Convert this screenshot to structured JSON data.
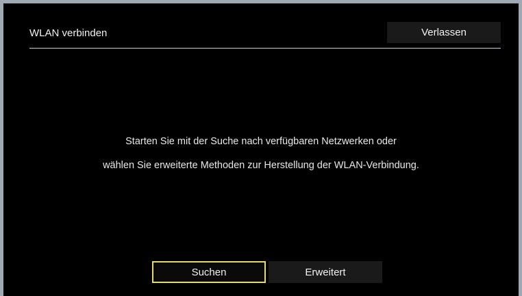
{
  "dialog": {
    "title": "WLAN verbinden",
    "exit_label": "Verlassen"
  },
  "message": {
    "line1": "Starten Sie mit der Suche nach verfügbaren Netzwerken oder",
    "line2": "wählen Sie erweiterte Methoden zur Herstellung der WLAN-Verbindung."
  },
  "buttons": {
    "search_label": "Suchen",
    "advanced_label": "Erweitert",
    "selected": "Suchen"
  },
  "colors": {
    "background": "#000000",
    "frame": "#9fa9b3",
    "focus_border": "#e7dc6a",
    "button_bg": "#1a1a1a",
    "text": "#f2f2f2"
  }
}
